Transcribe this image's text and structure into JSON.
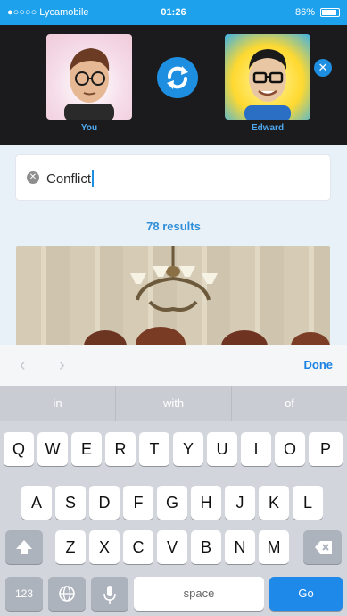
{
  "status_bar": {
    "carrier": "●○○○○ Lycamobile",
    "time": "01:26",
    "battery": "86%"
  },
  "header": {
    "you_label": "You",
    "friend_label": "Edward",
    "close_glyph": "✕"
  },
  "search": {
    "value": "Conflict",
    "clear_glyph": "✕"
  },
  "results": {
    "count_text": "78 results"
  },
  "accessory": {
    "prev_glyph": "‹",
    "next_glyph": "›",
    "done_label": "Done"
  },
  "keyboard": {
    "predictions": [
      "in",
      "with",
      "of"
    ],
    "row1": [
      "Q",
      "W",
      "E",
      "R",
      "T",
      "Y",
      "U",
      "I",
      "O",
      "P"
    ],
    "row2": [
      "A",
      "S",
      "D",
      "F",
      "G",
      "H",
      "J",
      "K",
      "L"
    ],
    "row3": [
      "Z",
      "X",
      "C",
      "V",
      "B",
      "N",
      "M"
    ],
    "numbers_label": "123",
    "space_label": "space",
    "go_label": "Go"
  },
  "colors": {
    "accent": "#1e8fe0",
    "status_bar": "#1da1ec",
    "header_bg": "#1b1b1d"
  }
}
